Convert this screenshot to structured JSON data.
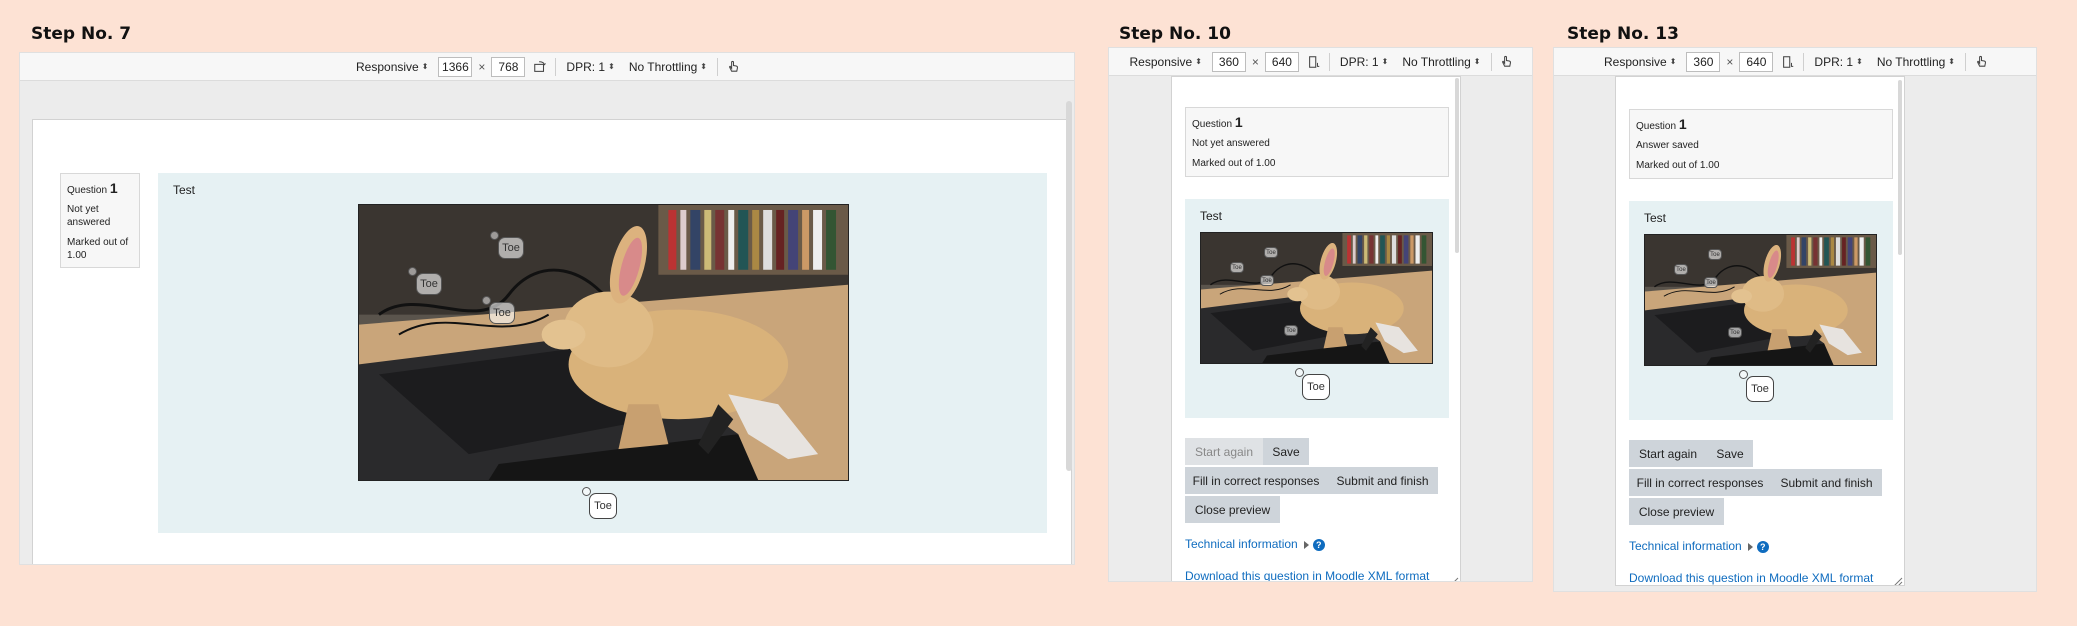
{
  "steps": [
    {
      "title": "Step No. 7",
      "toolbar": {
        "device": "Responsive",
        "width": "1366",
        "height": "768",
        "times": "×",
        "dpr": "DPR: 1",
        "throttle": "No Throttling"
      },
      "question": {
        "label": "Question",
        "number": "1",
        "status": "Not yet answered",
        "mark": "Marked out of 1.00"
      },
      "qtext": "Test",
      "drag_label": "Toe"
    },
    {
      "title": "Step No. 10",
      "toolbar": {
        "device": "Responsive",
        "width": "360",
        "height": "640",
        "times": "×",
        "dpr": "DPR: 1",
        "throttle": "No Throttling"
      },
      "question": {
        "label": "Question",
        "number": "1",
        "status": "Not yet answered",
        "mark": "Marked out of 1.00"
      },
      "qtext": "Test",
      "drag_label": "Toe"
    },
    {
      "title": "Step No. 13",
      "toolbar": {
        "device": "Responsive",
        "width": "360",
        "height": "640",
        "times": "×",
        "dpr": "DPR: 1",
        "throttle": "No Throttling"
      },
      "question": {
        "label": "Question",
        "number": "1",
        "status": "Answer saved",
        "mark": "Marked out of 1.00"
      },
      "qtext": "Test",
      "drag_label": "Toe"
    }
  ],
  "buttons": {
    "start_again": "Start again",
    "save": "Save",
    "fill_correct": "Fill in correct responses",
    "submit_finish": "Submit and finish",
    "close_preview": "Close preview"
  },
  "links": {
    "technical_information": "Technical information",
    "help_glyph": "?",
    "download_xml": "Download this question in Moodle XML format"
  },
  "colors": {
    "background": "#fde2d4",
    "formulation": "#e6f1f3",
    "button": "#ced4da",
    "link": "#0f6cbf"
  }
}
